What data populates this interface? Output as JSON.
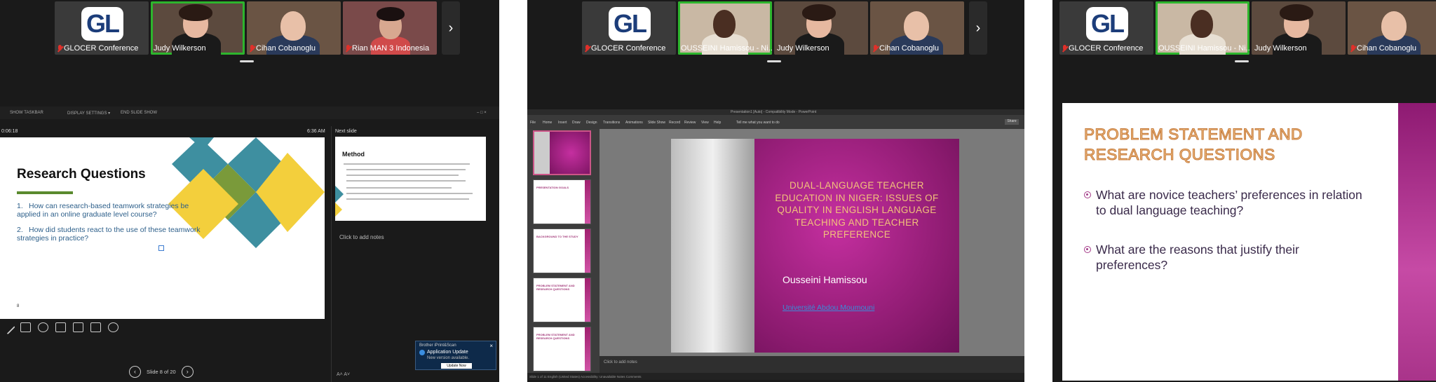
{
  "pane1": {
    "participants": [
      {
        "name": "GLOCER Conference",
        "logo": "GL",
        "muted": true
      },
      {
        "name": "Judy Wilkerson",
        "muted": false,
        "active": true
      },
      {
        "name": "Cihan Cobanoglu",
        "muted": true
      },
      {
        "name": "Rian MAN 3 Indonesia",
        "muted": true
      }
    ],
    "toolbar": {
      "show_taskbar": "SHOW TASKBAR",
      "display_settings": "DISPLAY SETTINGS ▾",
      "end_show": "END SLIDE SHOW"
    },
    "timer": "0:06:18",
    "clock": "6:36 AM",
    "next_slide_label": "Next slide",
    "current_slide": {
      "title": "Research Questions",
      "questions": [
        {
          "num": "1.",
          "text": "How can research-based teamwork strategies be applied in an online graduate level course?"
        },
        {
          "num": "2.",
          "text": "How did students react to the use of these teamwork strategies in practice?"
        }
      ],
      "slide_number": "8"
    },
    "next_slide": {
      "title": "Method"
    },
    "add_notes": "Click to add notes",
    "slide_nav": "Slide 8 of 20",
    "font_controls": "A˄  A˅",
    "toast": {
      "source": "Brother iPrint&Scan",
      "title": "Application Update",
      "message": "New version available.",
      "button": "Update Now"
    }
  },
  "pane2": {
    "participants": [
      {
        "name": "GLOCER Conference",
        "logo": "GL",
        "muted": true
      },
      {
        "name": "OUSSEINI Hamissou - Ni...",
        "muted": false,
        "active": true
      },
      {
        "name": "Judy Wilkerson",
        "muted": false
      },
      {
        "name": "Cihan Cobanoglu",
        "muted": true
      }
    ],
    "window_title": "Presentation1 [Auto] - Compatibility Mode - PowerPoint",
    "ribbon_tabs": [
      "File",
      "Home",
      "Insert",
      "Draw",
      "Design",
      "Transitions",
      "Animations",
      "Slide Show",
      "Record",
      "Review",
      "View",
      "Help",
      "Tell me what you want to do"
    ],
    "share": "Share",
    "thumbnails": [
      "",
      "PRESENTATION GOALS",
      "BACKGROUND TO THE STUDY",
      "PROBLEM STATEMENT AND RESEARCH QUESTIONS",
      "PROBLEM STATEMENT AND RESEARCH QUESTIONS"
    ],
    "slide": {
      "title": "DUAL-LANGUAGE TEACHER EDUCATION IN NIGER: ISSUES OF QUALITY IN ENGLISH LANGUAGE TEACHING AND TEACHER PREFERENCE",
      "presenter": "Ousseini Hamissou",
      "university": "Université Abdou Moumouni"
    },
    "notes": "Click to add notes",
    "status": "Slide 1 of 11   English (United States)   Accessibility: Unavailable                Notes   Comments"
  },
  "pane3": {
    "participants": [
      {
        "name": "GLOCER Conference",
        "logo": "GL",
        "muted": true
      },
      {
        "name": "OUSSEINI Hamissou - Ni...",
        "muted": false,
        "active": true
      },
      {
        "name": "Judy Wilkerson",
        "muted": false
      },
      {
        "name": "Cihan Cobanoglu",
        "muted": true
      }
    ],
    "slide": {
      "title_line1": "PROBLEM STATEMENT AND",
      "title_line2": "RESEARCH QUESTIONS",
      "bullets": [
        "What are novice teachers’ preferences in relation to dual language teaching?",
        "What are the reasons that justify their preferences?"
      ]
    }
  },
  "icons": {
    "next": "chevron-right-icon",
    "prev": "chevron-left-icon",
    "mic_muted": "mic-muted-icon"
  },
  "colors": {
    "active_speaker": "#2db52d",
    "muted_mic": "#e0302a",
    "slide_magenta": "#a0206f",
    "title_gold": "#f2c27a"
  }
}
